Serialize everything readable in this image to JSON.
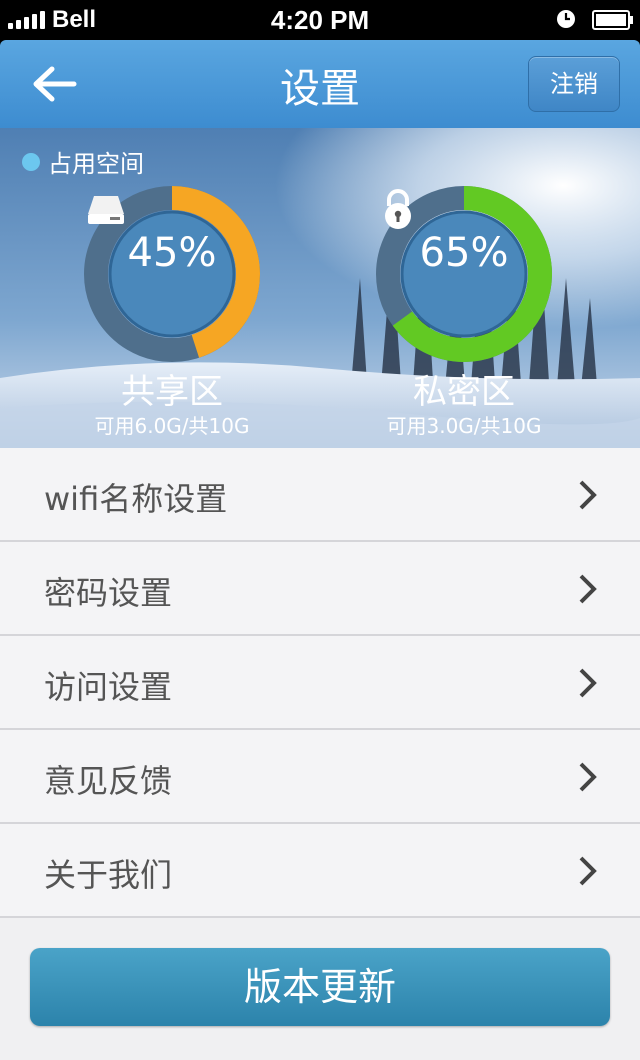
{
  "status_bar": {
    "carrier": "Bell",
    "time": "4:20 PM"
  },
  "header": {
    "title": "设置",
    "logout_label": "注销"
  },
  "usage": {
    "label": "占用空间",
    "shared": {
      "percent_label": "45%",
      "percent": 45,
      "name": "共享区",
      "availability": "可用6.0G/共10G",
      "color": "#f6a623",
      "icon": "drive-icon"
    },
    "private": {
      "percent_label": "65%",
      "percent": 65,
      "name": "私密区",
      "availability": "可用3.0G/共10G",
      "color": "#62c923",
      "icon": "lock-icon"
    }
  },
  "menu": {
    "items": [
      {
        "label": "wifi名称设置"
      },
      {
        "label": "密码设置"
      },
      {
        "label": "访问设置"
      },
      {
        "label": "意见反馈"
      },
      {
        "label": "关于我们"
      }
    ]
  },
  "update_button": {
    "label": "版本更新"
  },
  "colors": {
    "header": "#4a97d8",
    "button": "#3a94bb",
    "ring_track": "#4f6f8c"
  }
}
